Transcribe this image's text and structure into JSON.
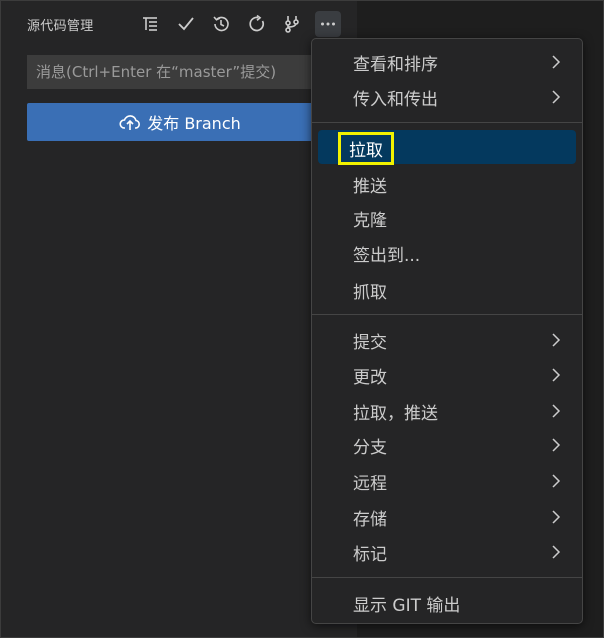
{
  "panel": {
    "title": "源代码管理",
    "toolbar": {
      "icons": [
        "view-as-tree-icon",
        "commit-check-icon",
        "history-icon",
        "refresh-icon",
        "graph-icon",
        "more-actions-icon"
      ]
    }
  },
  "commit": {
    "placeholder": "消息(Ctrl+Enter 在“master”提交)",
    "value": ""
  },
  "publish_button": {
    "label": "发布 Branch",
    "icon": "cloud-upload-icon",
    "color": "#3a6fb5"
  },
  "menu": {
    "items": [
      {
        "label": "查看和排序",
        "has_submenu": true
      },
      {
        "label": "传入和传出",
        "has_submenu": true
      },
      {
        "label": "拉取",
        "has_submenu": false,
        "selected": true
      },
      {
        "label": "推送",
        "has_submenu": false
      },
      {
        "label": "克隆",
        "has_submenu": false
      },
      {
        "label": "签出到...",
        "has_submenu": false
      },
      {
        "label": "抓取",
        "has_submenu": false
      },
      {
        "label": "提交",
        "has_submenu": true
      },
      {
        "label": "更改",
        "has_submenu": true
      },
      {
        "label": "拉取，推送",
        "has_submenu": true
      },
      {
        "label": "分支",
        "has_submenu": true
      },
      {
        "label": "远程",
        "has_submenu": true
      },
      {
        "label": "存储",
        "has_submenu": true
      },
      {
        "label": "标记",
        "has_submenu": true
      },
      {
        "label": "显示 GIT 输出",
        "has_submenu": false
      }
    ],
    "highlight_color": "#f2f200"
  }
}
